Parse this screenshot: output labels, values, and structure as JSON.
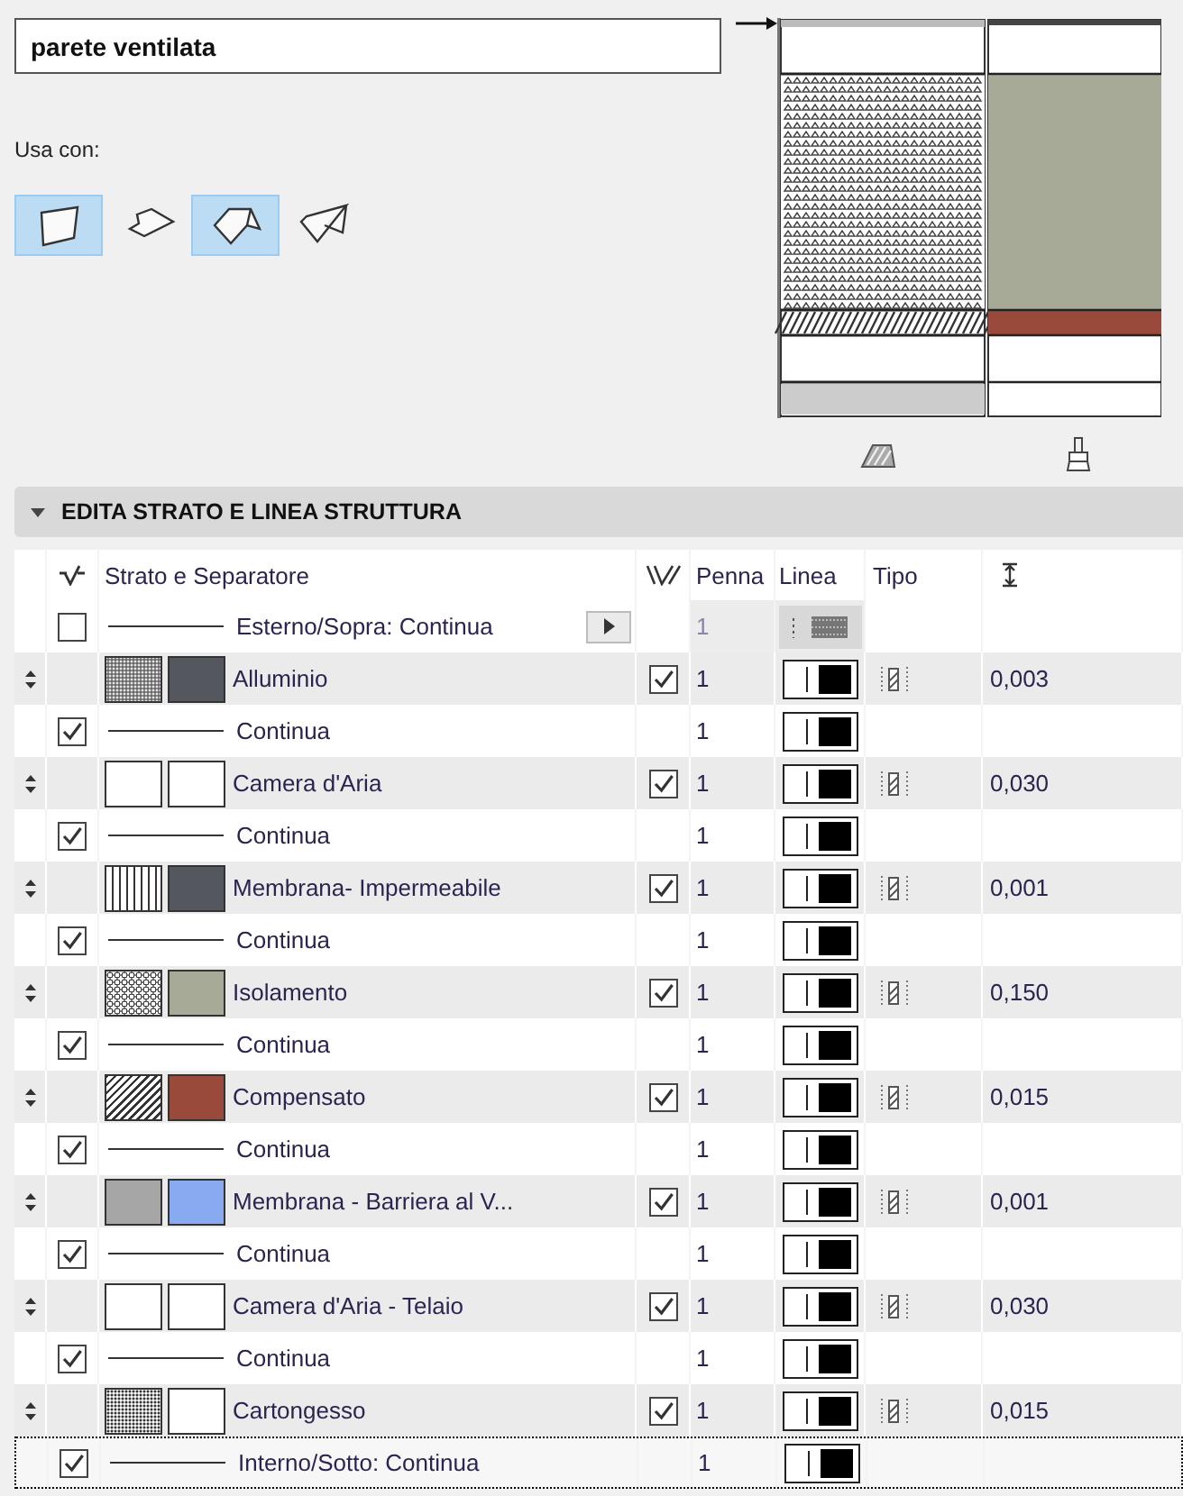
{
  "name_field": {
    "value": "parete ventilata"
  },
  "usa_con": {
    "label": "Usa con:",
    "options": [
      {
        "kind": "wall",
        "selected": true
      },
      {
        "kind": "slab",
        "selected": false
      },
      {
        "kind": "roof",
        "selected": true
      },
      {
        "kind": "shell",
        "selected": false
      }
    ]
  },
  "section": {
    "title": "EDITA STRATO E LINEA STRUTTURA",
    "expanded": true
  },
  "table": {
    "columns": [
      "Strato e Separatore",
      "Penna",
      "Linea",
      "Tipo"
    ],
    "rows": [
      {
        "kind": "outer",
        "name": "Esterno/Sopra: Continua",
        "checked": false,
        "pen": "1",
        "selected": false
      },
      {
        "kind": "layer",
        "name": "Alluminio",
        "fill": {
          "kind": "dots"
        },
        "color": "#55575e",
        "checked": true,
        "pen": "1",
        "thickness": "0,003",
        "selected": false
      },
      {
        "kind": "line",
        "name": "Continua",
        "checked": true,
        "pen": "1",
        "selected": false
      },
      {
        "kind": "layer",
        "name": "Camera d'Aria",
        "fill": {
          "kind": "blank"
        },
        "color": "#ffffff",
        "checked": true,
        "pen": "1",
        "thickness": "0,030",
        "selected": false
      },
      {
        "kind": "line",
        "name": "Continua",
        "checked": true,
        "pen": "1",
        "selected": false
      },
      {
        "kind": "layer",
        "name": "Membrana- Impermeabile",
        "fill": {
          "kind": "vertical"
        },
        "color": "#55575e",
        "checked": true,
        "pen": "1",
        "thickness": "0,001",
        "selected": false
      },
      {
        "kind": "line",
        "name": "Continua",
        "checked": true,
        "pen": "1",
        "selected": false
      },
      {
        "kind": "layer",
        "name": "Isolamento",
        "fill": {
          "kind": "insulation"
        },
        "color": "#a8aa98",
        "checked": true,
        "pen": "1",
        "thickness": "0,150",
        "selected": false
      },
      {
        "kind": "line",
        "name": "Continua",
        "checked": true,
        "pen": "1",
        "selected": false
      },
      {
        "kind": "layer",
        "name": "Compensato",
        "fill": {
          "kind": "diagonal"
        },
        "color": "#9a4a3a",
        "checked": true,
        "pen": "1",
        "thickness": "0,015",
        "selected": false
      },
      {
        "kind": "line",
        "name": "Continua",
        "checked": true,
        "pen": "1",
        "selected": false
      },
      {
        "kind": "layer",
        "name": "Membrana - Barriera al V...",
        "fill": {
          "kind": "solid"
        },
        "color": "#88aaf0",
        "checked": true,
        "pen": "1",
        "thickness": "0,001",
        "selected": false
      },
      {
        "kind": "line",
        "name": "Continua",
        "checked": true,
        "pen": "1",
        "selected": false
      },
      {
        "kind": "layer",
        "name": "Camera d'Aria - Telaio",
        "fill": {
          "kind": "blank"
        },
        "color": "#ffffff",
        "checked": true,
        "pen": "1",
        "thickness": "0,030",
        "selected": false
      },
      {
        "kind": "line",
        "name": "Continua",
        "checked": true,
        "pen": "1",
        "selected": false
      },
      {
        "kind": "layer",
        "name": "Cartongesso",
        "fill": {
          "kind": "fine"
        },
        "color": "#ffffff",
        "checked": true,
        "pen": "1",
        "thickness": "0,015",
        "selected": false
      },
      {
        "kind": "line",
        "name": "Interno/Sotto: Continua",
        "checked": true,
        "pen": "1",
        "selected": true
      }
    ]
  }
}
